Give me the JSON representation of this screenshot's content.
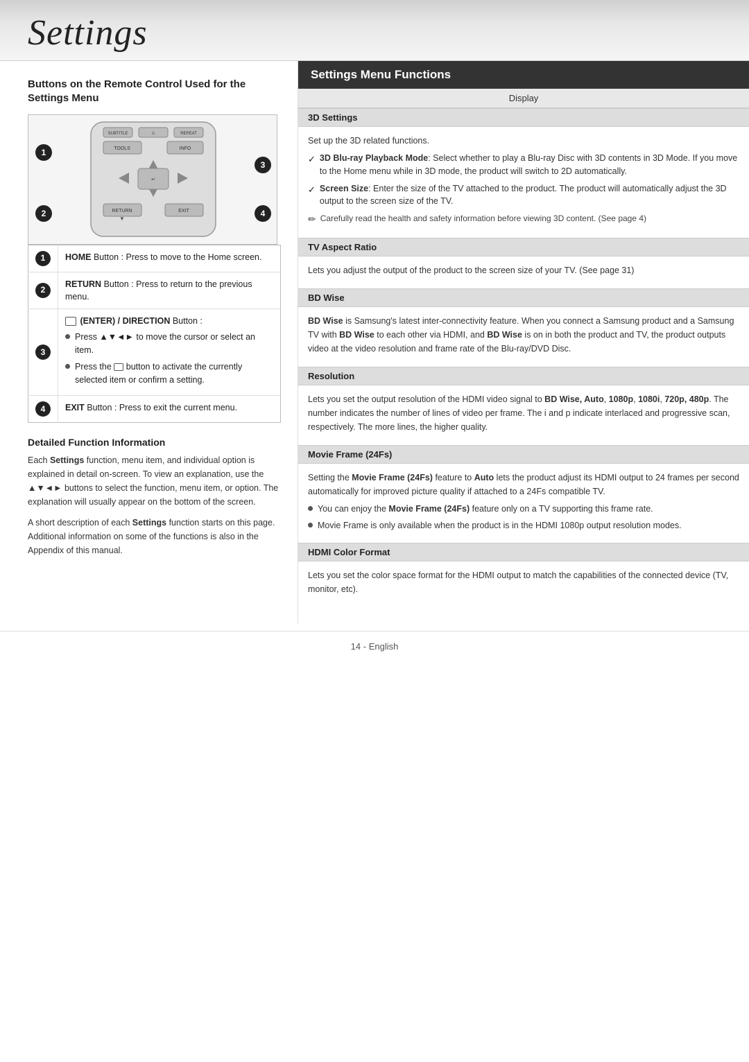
{
  "header": {
    "title": "Settings"
  },
  "left": {
    "section_title": "Buttons on the Remote Control Used for the Settings Menu",
    "buttons": [
      {
        "number": "1",
        "label": "HOME Button : Press to move to the Home screen."
      },
      {
        "number": "2",
        "label": "RETURN Button : Press to return to the previous menu."
      },
      {
        "number": "3",
        "content_type": "enter_direction",
        "line1": "(ENTER) / DIRECTION Button :",
        "bullet1": "Press ▲▼◄► to move the cursor or select an item.",
        "bullet2": "Press the  button to activate the currently selected item or confirm a setting."
      },
      {
        "number": "4",
        "label": "EXIT Button : Press to exit the current menu."
      }
    ],
    "detailed_heading": "Detailed Function Information",
    "detailed_para1": "Each Settings function, menu item, and individual option is explained in detail on-screen. To view an explanation, use the ▲▼◄► buttons to select the function, menu item, or option. The explanation will usually appear on the bottom of the screen.",
    "detailed_para2": "A short description of each Settings function starts on this page. Additional information on some of the functions is also in the Appendix of this manual."
  },
  "right": {
    "main_title": "Settings Menu Functions",
    "display_label": "Display",
    "sections": [
      {
        "id": "3d-settings",
        "label": "3D Settings",
        "intro": "Set up the 3D related functions.",
        "checks": [
          {
            "title": "3D Blu-ray Playback Mode",
            "text": ": Select whether to play a Blu-ray Disc with 3D contents in 3D Mode. If you move to the Home menu while in 3D mode, the product will switch to 2D automatically."
          },
          {
            "title": "Screen Size",
            "text": ": Enter the size of the TV attached to the product. The product will automatically adjust the 3D output to the screen size of the TV."
          }
        ],
        "notes": [
          "Carefully read the health and safety information before viewing 3D content. (See page 4)"
        ]
      },
      {
        "id": "tv-aspect-ratio",
        "label": "TV Aspect Ratio",
        "body": "Lets you adjust the output of the product to the screen size of your TV. (See page 31)"
      },
      {
        "id": "bd-wise",
        "label": "BD Wise",
        "body_parts": [
          {
            "type": "text",
            "content": "BD Wise",
            "bold": true
          },
          {
            "type": "text",
            "content": " is Samsung's latest inter-connectivity feature. When you connect a Samsung product and a Samsung TV with "
          },
          {
            "type": "text",
            "content": "BD Wise",
            "bold": true
          },
          {
            "type": "text",
            "content": " to each other via HDMI, and "
          },
          {
            "type": "text",
            "content": "BD Wise",
            "bold": true
          },
          {
            "type": "text",
            "content": " is on in both the product and TV, the product outputs video at the video resolution and frame rate of the Blu-ray/DVD Disc."
          }
        ]
      },
      {
        "id": "resolution",
        "label": "Resolution",
        "body_parts": [
          {
            "type": "text",
            "content": "Lets you set the output resolution of the HDMI video signal to "
          },
          {
            "type": "text",
            "content": "BD Wise, Auto",
            "bold": true
          },
          {
            "type": "text",
            "content": ", "
          },
          {
            "type": "text",
            "content": "1080p",
            "bold": true
          },
          {
            "type": "text",
            "content": ", "
          },
          {
            "type": "text",
            "content": "1080i",
            "bold": true
          },
          {
            "type": "text",
            "content": ", "
          },
          {
            "type": "text",
            "content": "720p, 480p",
            "bold": true
          },
          {
            "type": "text",
            "content": ". The number indicates the number of lines of video per frame. The i and p indicate interlaced and progressive scan, respectively. The more lines, the higher quality."
          }
        ]
      },
      {
        "id": "movie-frame",
        "label": "Movie Frame (24Fs)",
        "intro_parts": [
          {
            "type": "text",
            "content": "Setting the "
          },
          {
            "type": "text",
            "content": "Movie Frame (24Fs)",
            "bold": true
          },
          {
            "type": "text",
            "content": " feature to "
          },
          {
            "type": "text",
            "content": "Auto",
            "bold": true
          },
          {
            "type": "text",
            "content": " lets the product adjust its HDMI output to 24 frames per second automatically for improved picture quality if attached to a 24Fs compatible TV."
          }
        ],
        "bullets": [
          {
            "parts": [
              {
                "type": "text",
                "content": "You can enjoy the "
              },
              {
                "type": "text",
                "content": "Movie Frame (24Fs)",
                "bold": true
              },
              {
                "type": "text",
                "content": " feature only on a TV supporting this frame rate."
              }
            ]
          },
          {
            "parts": [
              {
                "type": "text",
                "content": "Movie Frame is only available when the product is in the HDMI 1080p output resolution modes."
              }
            ]
          }
        ]
      },
      {
        "id": "hdmi-color-format",
        "label": "HDMI Color Format",
        "body": "Lets you set the color space format for the HDMI output to match the capabilities of the connected device (TV, monitor, etc)."
      }
    ]
  },
  "footer": {
    "page_number": "14",
    "language": "English"
  }
}
